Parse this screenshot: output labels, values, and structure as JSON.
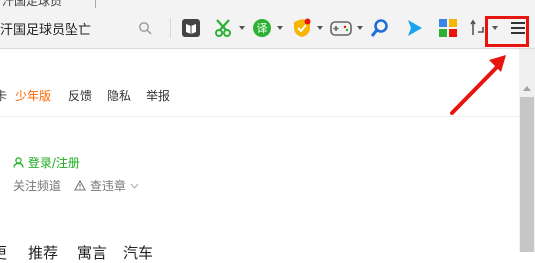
{
  "browser": {
    "tab_title": "汗国足球员",
    "address_text": "汗国足球员坠亡",
    "toolbar_icons": [
      "search-icon",
      "reader-icon",
      "scissors-icon",
      "translate-icon",
      "shield-icon",
      "game-icon",
      "zoom-icon",
      "play-icon",
      "apps-icon",
      "back-forward-icon",
      "menu-icon"
    ]
  },
  "topnav": {
    "items": [
      "卡",
      "少年版",
      "反馈",
      "隐私",
      "举报"
    ],
    "active_index": 1
  },
  "account": {
    "login_label": "登录/注册",
    "follow_channels": "关注频道",
    "violation_check": "查违章"
  },
  "bottom_tabs": [
    "更",
    "推荐",
    "寓言",
    "汽车"
  ],
  "colors": {
    "accent_orange": "#ff6600",
    "login_green": "#1aad19",
    "highlight_red": "#e8140e"
  }
}
